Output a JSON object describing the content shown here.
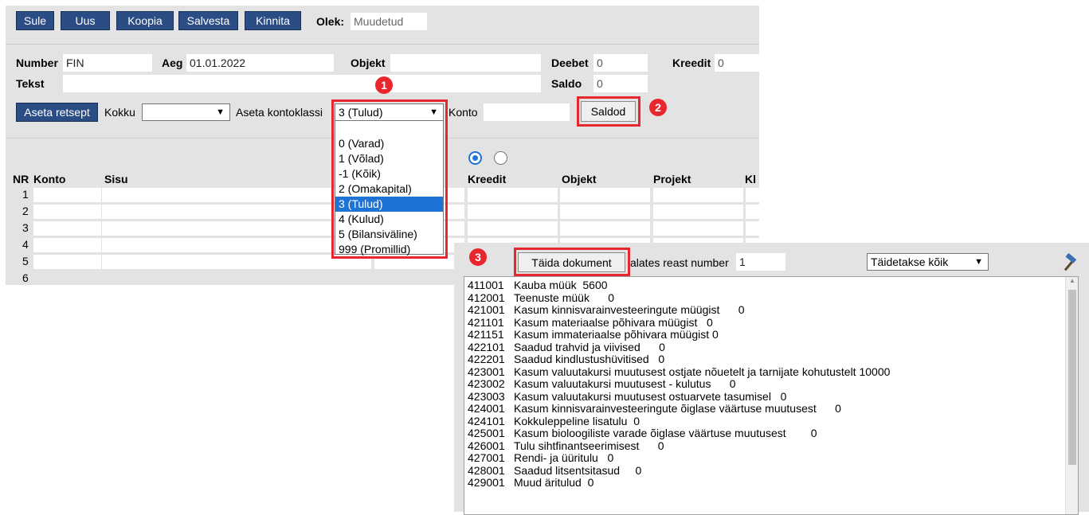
{
  "toolbar": {
    "buttons": [
      "Sule",
      "Uus",
      "Koopia",
      "Salvesta",
      "Kinnita"
    ],
    "state_label": "Olek:",
    "state_value": "Muudetud"
  },
  "header": {
    "number_label": "Number",
    "number_value": "FIN",
    "aeg_label": "Aeg",
    "aeg_value": "01.01.2022",
    "objekt_label": "Objekt",
    "deebet_label": "Deebet",
    "deebet_value": "0",
    "kreedit_label": "Kreedit",
    "kreedit_value": "0",
    "tekst_label": "Tekst",
    "saldo_label": "Saldo",
    "saldo_value": "0"
  },
  "actions": {
    "aseta_retsept": "Aseta retsept",
    "kokku_label": "Kokku",
    "kokku_value": "",
    "kontoklass_label": "Aseta kontoklassi",
    "kontoklass_value": "3 (Tulud)",
    "konto_label": "Konto",
    "saldod_button": "Saldod"
  },
  "kontoklass_options": [
    "",
    "0 (Varad)",
    "1 (Võlad)",
    "-1 (Kõik)",
    "2 (Omakapital)",
    "3 (Tulud)",
    "4 (Kulud)",
    "5 (Bilansiväline)",
    "999 (Promillid)"
  ],
  "kontoklass_selected_index": 5,
  "grid": {
    "headers": [
      "NR",
      "Konto",
      "Sisu",
      "Kreedit",
      "Objekt",
      "Projekt",
      "Kl"
    ],
    "rows": [
      "1",
      "2",
      "3",
      "4",
      "5",
      "6"
    ]
  },
  "badges": [
    "1",
    "2",
    "3"
  ],
  "fill_panel": {
    "fill_button": "Täida dokument",
    "from_row_label": "alates reast number",
    "from_row_value": "1",
    "mode_value": "Täidetakse kõik",
    "accounts": [
      {
        "code": "411001",
        "text": "Kauba müük  5600"
      },
      {
        "code": "412001",
        "text": "Teenuste müük      0"
      },
      {
        "code": "421001",
        "text": "Kasum kinnisvarainvesteeringute müügist      0"
      },
      {
        "code": "421101",
        "text": "Kasum materiaalse põhivara müügist   0"
      },
      {
        "code": "421151",
        "text": "Kasum immateriaalse põhivara müügist 0"
      },
      {
        "code": "422101",
        "text": "Saadud trahvid ja viivised      0"
      },
      {
        "code": "422201",
        "text": "Saadud kindlustushüvitised   0"
      },
      {
        "code": "423001",
        "text": "Kasum valuutakursi muutusest ostjate nõuetelt ja tarnijate kohutustelt 10000"
      },
      {
        "code": "423002",
        "text": "Kasum valuutakursi muutusest - kulutus      0"
      },
      {
        "code": "423003",
        "text": "Kasum valuutakursi muutusest ostuarvete tasumisel   0"
      },
      {
        "code": "424001",
        "text": "Kasum kinnisvarainvesteeringute õiglase väärtuse muutusest      0"
      },
      {
        "code": "424101",
        "text": "Kokkuleppeline lisatulu  0"
      },
      {
        "code": "425001",
        "text": "Kasum bioloogiliste varade õiglase väärtuse muutusest        0"
      },
      {
        "code": "426001",
        "text": "Tulu sihtfinantseerimisest      0"
      },
      {
        "code": "427001",
        "text": "Rendi- ja üüritulu   0"
      },
      {
        "code": "428001",
        "text": "Saadud litsentsitasud     0"
      },
      {
        "code": "429001",
        "text": "Muud äritulud  0"
      }
    ]
  }
}
